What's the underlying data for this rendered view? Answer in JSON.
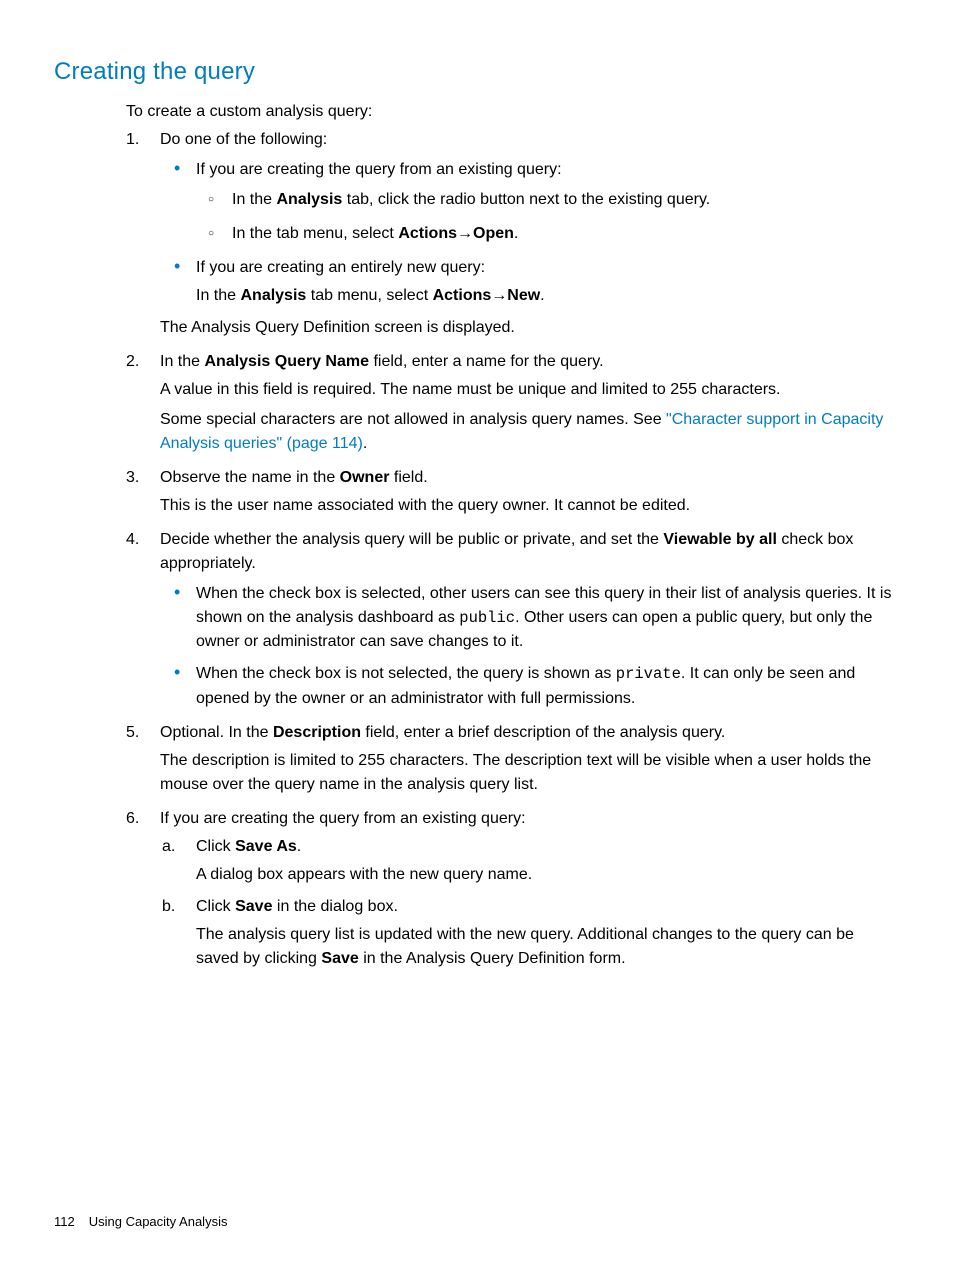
{
  "title": "Creating the query",
  "intro": "To create a custom analysis query:",
  "step1": {
    "num": "1.",
    "lead": "Do one of the following:",
    "b1": {
      "lead": "If you are creating the query from an existing query:",
      "s1a": "In the ",
      "s1b": "Analysis",
      "s1c": " tab, click the radio button next to the existing query.",
      "s2a": "In the tab menu, select ",
      "s2b": "Actions",
      "s2c": "Open",
      "s2d": "."
    },
    "b2": {
      "lead": "If you are creating an entirely new query:",
      "pa": "In the ",
      "pb": "Analysis",
      "pc": " tab menu, select ",
      "pd": "Actions",
      "pe": "New",
      "pf": "."
    },
    "after": "The Analysis Query Definition screen is displayed."
  },
  "step2": {
    "num": "2.",
    "la": "In the ",
    "lb": "Analysis Query Name",
    "lc": " field, enter a name for the query.",
    "p1": "A value in this field is required. The name must be unique and limited to 255 characters.",
    "p2a": "Some special characters are not allowed in analysis query names. See ",
    "p2link": "\"Character support in Capacity Analysis queries\" (page 114)",
    "p2b": "."
  },
  "step3": {
    "num": "3.",
    "la": "Observe the name in the ",
    "lb": "Owner",
    "lc": " field.",
    "p1": "This is the user name associated with the query owner. It cannot be edited."
  },
  "step4": {
    "num": "4.",
    "la": "Decide whether the analysis query will be public or private, and set the ",
    "lb": "Viewable by all",
    "lc": " check box appropriately.",
    "b1a": "When the check box is selected, other users can see this query in their list of analysis queries. It is shown on the analysis dashboard as ",
    "b1code": "public",
    "b1b": ". Other users can open a public query, but only the owner or administrator can save changes to it.",
    "b2a": "When the check box is not selected, the query is shown as ",
    "b2code": "private",
    "b2b": ". It can only be seen and opened by the owner or an administrator with full permissions."
  },
  "step5": {
    "num": "5.",
    "la": "Optional. In the ",
    "lb": "Description",
    "lc": " field, enter a brief description of the analysis query.",
    "p1": "The description is limited to 255 characters. The description text will be visible when a user holds the mouse over the query name in the analysis query list."
  },
  "step6": {
    "num": "6.",
    "lead": "If you are creating the query from an existing query:",
    "a": {
      "lett": "a.",
      "la": "Click ",
      "lb": "Save As",
      "lc": ".",
      "p1": "A dialog box appears with the new query name."
    },
    "b": {
      "lett": "b.",
      "la": "Click ",
      "lb": "Save",
      "lc": " in the dialog box.",
      "p1a": "The analysis query list is updated with the new query. Additional changes to the query can be saved by clicking ",
      "p1b": "Save",
      "p1c": " in the Analysis Query Definition form."
    }
  },
  "arrow": "→",
  "footer": {
    "page": "112",
    "chapter": "Using Capacity Analysis"
  }
}
